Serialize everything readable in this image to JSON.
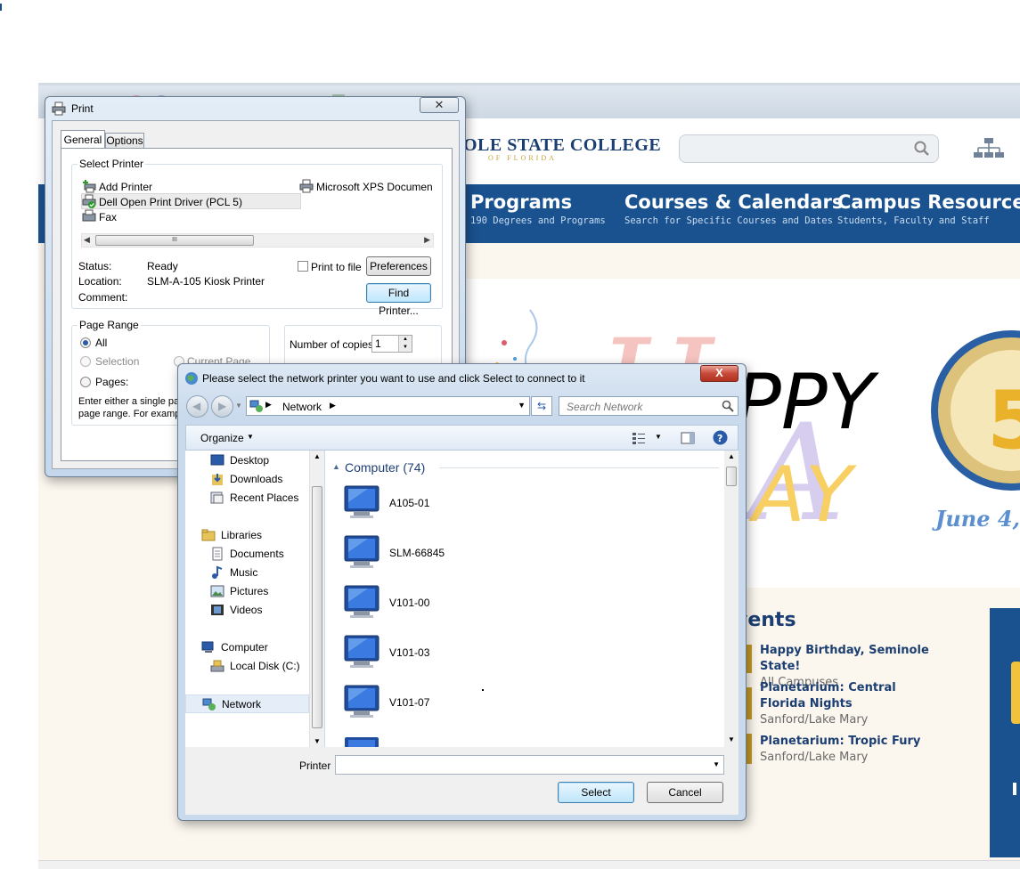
{
  "website": {
    "logo_text": "OLE STATE COLLEGE",
    "logo_sub": "OF FLORIDA",
    "nav": [
      {
        "title": "Programs",
        "sub": "190 Degrees and Programs"
      },
      {
        "title": "Courses & Calendars",
        "sub": "Search for Specific Courses and Dates"
      },
      {
        "title": "Campus Resources",
        "sub": "Students, Faculty and Staff"
      }
    ],
    "hero": {
      "word1": "PPY",
      "word2": "AY",
      "seal_number": "5",
      "date_text": "June 4,"
    },
    "events_heading": "vents",
    "events": [
      {
        "title": "Happy Birthday, Seminole State!",
        "location": "All Campuses"
      },
      {
        "title": "Planetarium: Central Florida Nights",
        "location": "Sanford/Lake Mary"
      },
      {
        "title": "Planetarium: Tropic Fury",
        "location": "Sanford/Lake Mary"
      }
    ],
    "colors": {
      "brand_blue": "#1a5290",
      "brand_gold": "#c29a2b"
    }
  },
  "print_dialog": {
    "title": "Print",
    "close_label": "✕",
    "tabs": [
      "General",
      "Options"
    ],
    "select_printer_label": "Select Printer",
    "printers": [
      {
        "name": "Add Printer",
        "icon": "add-printer-icon"
      },
      {
        "name": "Microsoft XPS Documen",
        "icon": "printer-icon"
      },
      {
        "name": "Dell Open Print Driver (PCL 5)",
        "icon": "default-printer-icon"
      },
      {
        "name": "Fax",
        "icon": "fax-icon"
      }
    ],
    "scroll_grip": "III",
    "status_label": "Status:",
    "status_value": "Ready",
    "location_label": "Location:",
    "location_value": "SLM-A-105 Kiosk Printer",
    "comment_label": "Comment:",
    "print_to_file_label": "Print to file",
    "preferences_label": "Preferences",
    "find_printer_label": "Find Printer...",
    "page_range_label": "Page Range",
    "range_all": "All",
    "range_selection": "Selection",
    "range_current_page": "Current Page",
    "range_pages": "Pages:",
    "page_range_hint_1": "Enter either a single pag",
    "page_range_hint_2": "page range.  For examp",
    "copies_label": "Number of copies:",
    "copies_value": "1"
  },
  "network_dialog": {
    "title": "Please select the network printer you want to use and click Select to connect to it",
    "close_label": "X",
    "breadcrumb": [
      "Network"
    ],
    "search_placeholder": "Search Network",
    "organize_label": "Organize",
    "nav_pane": [
      {
        "label": "Desktop",
        "icon": "desktop-icon"
      },
      {
        "label": "Downloads",
        "icon": "downloads-icon"
      },
      {
        "label": "Recent Places",
        "icon": "recent-places-icon"
      },
      {
        "label": "Libraries",
        "icon": "libraries-icon"
      },
      {
        "label": "Documents",
        "icon": "documents-icon"
      },
      {
        "label": "Music",
        "icon": "music-icon"
      },
      {
        "label": "Pictures",
        "icon": "pictures-icon"
      },
      {
        "label": "Videos",
        "icon": "videos-icon"
      },
      {
        "label": "Computer",
        "icon": "computer-icon"
      },
      {
        "label": "Local Disk (C:)",
        "icon": "local-disk-icon"
      },
      {
        "label": "Network",
        "icon": "network-icon"
      }
    ],
    "group_header": "Computer (74)",
    "computers": [
      "A105-01",
      "SLM-66845",
      "V101-00",
      "V101-03",
      "V101-07"
    ],
    "printer_field_label": "Printer",
    "printer_field_value": "",
    "select_label": "Select",
    "cancel_label": "Cancel"
  }
}
